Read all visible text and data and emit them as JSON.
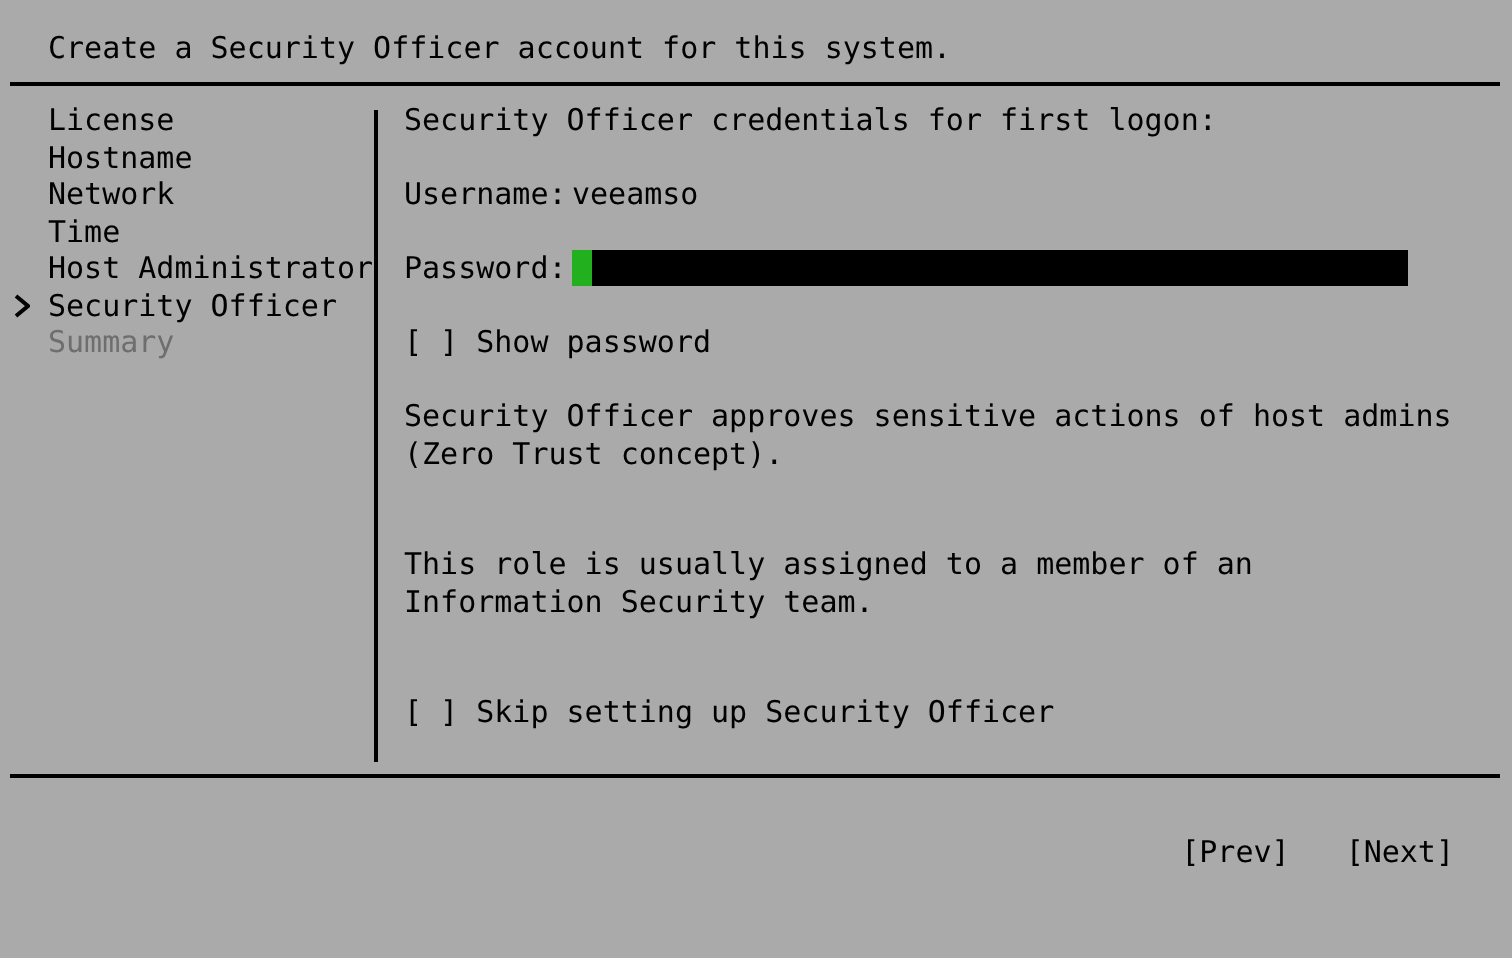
{
  "header": {
    "title": "Create a Security Officer account for this system."
  },
  "sidebar": {
    "items": [
      {
        "label": "License",
        "selected": false,
        "disabled": false
      },
      {
        "label": "Hostname",
        "selected": false,
        "disabled": false
      },
      {
        "label": "Network",
        "selected": false,
        "disabled": false
      },
      {
        "label": "Time",
        "selected": false,
        "disabled": false
      },
      {
        "label": "Host Administrator",
        "selected": false,
        "disabled": false
      },
      {
        "label": "Security Officer",
        "selected": true,
        "disabled": false
      },
      {
        "label": "Summary",
        "selected": false,
        "disabled": true
      }
    ]
  },
  "form": {
    "heading": "Security Officer credentials for first logon:",
    "username": {
      "label": "Username:",
      "value": "veeamso"
    },
    "password": {
      "label": "Password:"
    },
    "show_password": {
      "box": "[ ]",
      "label": "Show password",
      "checked": false
    },
    "description": [
      "Security Officer approves sensitive actions of host admins (Zero Trust concept).",
      "This role is usually assigned to a member of an Information Security team."
    ],
    "skip": {
      "box": "[ ]",
      "label": "Skip setting up Security Officer",
      "checked": false
    }
  },
  "buttons": [
    "[Prev]",
    "[Next]"
  ]
}
